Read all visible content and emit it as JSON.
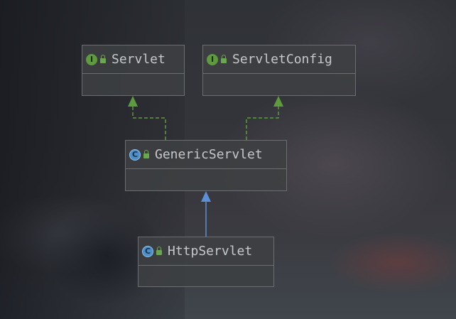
{
  "diagram": {
    "nodes": [
      {
        "id": "servlet",
        "name": "Servlet",
        "kind": "interface",
        "kind_glyph": "I",
        "visibility": "public"
      },
      {
        "id": "servlet-config",
        "name": "ServletConfig",
        "kind": "interface",
        "kind_glyph": "I",
        "visibility": "public"
      },
      {
        "id": "generic-servlet",
        "name": "GenericServlet",
        "kind": "class",
        "kind_glyph": "C",
        "visibility": "public"
      },
      {
        "id": "http-servlet",
        "name": "HttpServlet",
        "kind": "class",
        "kind_glyph": "C",
        "visibility": "public"
      }
    ],
    "edges": [
      {
        "from": "generic-servlet",
        "to": "servlet",
        "type": "implements"
      },
      {
        "from": "generic-servlet",
        "to": "servlet-config",
        "type": "implements"
      },
      {
        "from": "http-servlet",
        "to": "generic-servlet",
        "type": "extends"
      }
    ],
    "colors": {
      "implements_edge": "#5e9b3c",
      "extends_edge": "#5b8fd6",
      "interface_icon": "#5e9b3c",
      "class_icon": "#4d8fc9"
    }
  }
}
